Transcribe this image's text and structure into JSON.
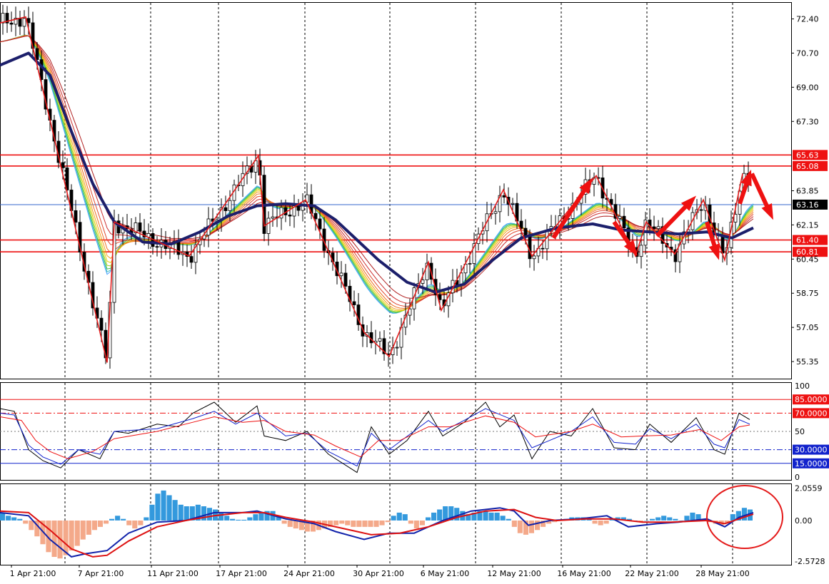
{
  "chart_data": [
    {
      "type": "candlestick",
      "panel": "price",
      "ylim": [
        54.5,
        73.2
      ],
      "yticks": [
        "72.40",
        "70.70",
        "69.00",
        "67.30",
        "65.63",
        "65.08",
        "63.85",
        "63.16",
        "62.15",
        "61.40",
        "60.81",
        "60.45",
        "58.75",
        "57.05",
        "55.35"
      ],
      "horizontal_levels": [
        {
          "label": "65.63",
          "value": 65.63,
          "color": "#ee1111",
          "highlight": true
        },
        {
          "label": "65.08",
          "value": 65.08,
          "color": "#ee1111",
          "highlight": true
        },
        {
          "label": "61.40",
          "value": 61.4,
          "color": "#ee1111",
          "highlight": true
        },
        {
          "label": "60.81",
          "value": 60.81,
          "color": "#ee1111",
          "highlight": true
        },
        {
          "label": "63.16",
          "value": 63.16,
          "color": "#3366cc",
          "highlight": false,
          "current": true
        }
      ],
      "zigzag": [
        [
          0,
          72.2
        ],
        [
          36,
          72.5
        ],
        [
          150,
          55.3
        ],
        [
          160,
          62.3
        ],
        [
          265,
          60.6
        ],
        [
          362,
          65.6
        ],
        [
          370,
          62.1
        ],
        [
          428,
          63.4
        ],
        [
          510,
          56.8
        ],
        [
          545,
          55.6
        ],
        [
          600,
          60.3
        ],
        [
          618,
          57.9
        ],
        [
          705,
          63.9
        ],
        [
          745,
          60.6
        ],
        [
          835,
          64.6
        ],
        [
          890,
          60.6
        ],
        [
          905,
          62.3
        ],
        [
          945,
          60.7
        ],
        [
          985,
          63.4
        ],
        [
          1015,
          60.4
        ],
        [
          1040,
          64.7
        ]
      ],
      "ma_slow": [
        [
          0,
          70.1
        ],
        [
          40,
          70.7
        ],
        [
          70,
          69.6
        ],
        [
          100,
          66.8
        ],
        [
          130,
          64.2
        ],
        [
          160,
          62.3
        ],
        [
          200,
          61.3
        ],
        [
          240,
          61.2
        ],
        [
          280,
          61.8
        ],
        [
          320,
          62.6
        ],
        [
          360,
          63.1
        ],
        [
          400,
          63.2
        ],
        [
          440,
          63.1
        ],
        [
          470,
          62.4
        ],
        [
          500,
          61.4
        ],
        [
          530,
          60.4
        ],
        [
          570,
          59.3
        ],
        [
          610,
          58.8
        ],
        [
          650,
          59.2
        ],
        [
          690,
          60.4
        ],
        [
          730,
          61.5
        ],
        [
          780,
          62.0
        ],
        [
          830,
          62.2
        ],
        [
          870,
          61.9
        ],
        [
          910,
          61.8
        ],
        [
          950,
          61.7
        ],
        [
          990,
          61.8
        ],
        [
          1025,
          61.5
        ],
        [
          1055,
          62.0
        ]
      ],
      "arrows": [
        {
          "from": [
            775,
            61.5
          ],
          "to": [
            830,
            64.5
          ]
        },
        {
          "from": [
            860,
            62.3
          ],
          "to": [
            893,
            60.6
          ]
        },
        {
          "from": [
            920,
            61.6
          ],
          "to": [
            975,
            63.6
          ]
        },
        {
          "from": [
            990,
            62.3
          ],
          "to": [
            1007,
            60.4
          ]
        },
        {
          "from": [
            1036,
            63.2
          ],
          "to": [
            1052,
            64.9
          ]
        },
        {
          "from": [
            1053,
            64.7
          ],
          "to": [
            1083,
            62.4
          ]
        }
      ]
    },
    {
      "type": "line",
      "panel": "oscillator",
      "ylim": [
        0,
        100
      ],
      "yticks": [
        "100",
        "50",
        "0"
      ],
      "levels": [
        {
          "label": "85.0000",
          "value": 85,
          "color": "#ee1111",
          "style": "solid"
        },
        {
          "label": "70.0000",
          "value": 70,
          "color": "#ee1111",
          "style": "dashdot"
        },
        {
          "label": "30.0000",
          "value": 30,
          "color": "#1122cc",
          "style": "dashdot"
        },
        {
          "label": "15.0000",
          "value": 15,
          "color": "#1122cc",
          "style": "solid"
        }
      ],
      "series": [
        {
          "color": "#000000",
          "values": [
            [
              0,
              75
            ],
            [
              20,
              72
            ],
            [
              40,
              30
            ],
            [
              60,
              18
            ],
            [
              85,
              10
            ],
            [
              110,
              30
            ],
            [
              140,
              20
            ],
            [
              160,
              50
            ],
            [
              180,
              48
            ],
            [
              220,
              58
            ],
            [
              250,
              55
            ],
            [
              270,
              70
            ],
            [
              300,
              82
            ],
            [
              330,
              60
            ],
            [
              360,
              78
            ],
            [
              370,
              45
            ],
            [
              400,
              40
            ],
            [
              430,
              50
            ],
            [
              460,
              25
            ],
            [
              500,
              5
            ],
            [
              520,
              55
            ],
            [
              545,
              25
            ],
            [
              570,
              40
            ],
            [
              600,
              72
            ],
            [
              620,
              45
            ],
            [
              650,
              60
            ],
            [
              680,
              82
            ],
            [
              700,
              55
            ],
            [
              720,
              68
            ],
            [
              745,
              20
            ],
            [
              770,
              50
            ],
            [
              800,
              45
            ],
            [
              830,
              75
            ],
            [
              860,
              32
            ],
            [
              890,
              30
            ],
            [
              910,
              58
            ],
            [
              940,
              38
            ],
            [
              975,
              65
            ],
            [
              1000,
              30
            ],
            [
              1015,
              25
            ],
            [
              1035,
              70
            ],
            [
              1050,
              63
            ]
          ]
        },
        {
          "color": "#1122cc",
          "values": [
            [
              0,
              70
            ],
            [
              20,
              68
            ],
            [
              40,
              35
            ],
            [
              60,
              22
            ],
            [
              85,
              14
            ],
            [
              110,
              30
            ],
            [
              140,
              25
            ],
            [
              160,
              50
            ],
            [
              220,
              53
            ],
            [
              270,
              64
            ],
            [
              300,
              72
            ],
            [
              330,
              58
            ],
            [
              360,
              70
            ],
            [
              400,
              45
            ],
            [
              430,
              48
            ],
            [
              460,
              28
            ],
            [
              500,
              12
            ],
            [
              520,
              48
            ],
            [
              545,
              30
            ],
            [
              600,
              62
            ],
            [
              620,
              50
            ],
            [
              650,
              62
            ],
            [
              680,
              75
            ],
            [
              720,
              62
            ],
            [
              745,
              32
            ],
            [
              800,
              50
            ],
            [
              830,
              66
            ],
            [
              860,
              38
            ],
            [
              890,
              36
            ],
            [
              910,
              53
            ],
            [
              940,
              42
            ],
            [
              975,
              58
            ],
            [
              1000,
              36
            ],
            [
              1015,
              32
            ],
            [
              1035,
              63
            ],
            [
              1050,
              58
            ]
          ]
        },
        {
          "color": "#ee1111",
          "values": [
            [
              0,
              66
            ],
            [
              30,
              62
            ],
            [
              50,
              40
            ],
            [
              70,
              28
            ],
            [
              95,
              20
            ],
            [
              130,
              28
            ],
            [
              160,
              42
            ],
            [
              220,
              50
            ],
            [
              270,
              60
            ],
            [
              300,
              66
            ],
            [
              340,
              60
            ],
            [
              370,
              62
            ],
            [
              400,
              50
            ],
            [
              440,
              46
            ],
            [
              470,
              34
            ],
            [
              505,
              22
            ],
            [
              530,
              40
            ],
            [
              560,
              40
            ],
            [
              600,
              55
            ],
            [
              630,
              55
            ],
            [
              680,
              67
            ],
            [
              720,
              60
            ],
            [
              750,
              44
            ],
            [
              800,
              50
            ],
            [
              830,
              58
            ],
            [
              870,
              44
            ],
            [
              900,
              45
            ],
            [
              940,
              46
            ],
            [
              980,
              52
            ],
            [
              1010,
              40
            ],
            [
              1035,
              55
            ],
            [
              1050,
              57
            ]
          ]
        }
      ]
    },
    {
      "type": "histogram",
      "panel": "macd",
      "ylim": [
        -2.8,
        2.3
      ],
      "yticks": [
        "2.0559",
        "0.00",
        "-2.5728"
      ],
      "histogram": [
        0.45,
        0.3,
        0.2,
        0.1,
        -0.2,
        -0.6,
        -1.0,
        -1.5,
        -2.0,
        -2.3,
        -2.4,
        -2.2,
        -1.9,
        -1.6,
        -1.2,
        -0.9,
        -0.6,
        -0.4,
        -0.2,
        0.1,
        0.3,
        0.1,
        -0.3,
        -0.5,
        -0.3,
        0.2,
        1.0,
        1.7,
        1.9,
        1.6,
        1.3,
        1.0,
        0.9,
        0.9,
        1.0,
        0.9,
        0.8,
        0.7,
        0.5,
        0.3,
        0.1,
        0.05,
        0.05,
        0.2,
        0.4,
        0.5,
        0.6,
        0.6,
        0.3,
        -0.2,
        -0.4,
        -0.5,
        -0.6,
        -0.7,
        -0.7,
        -0.6,
        -0.5,
        -0.4,
        -0.3,
        -0.2,
        -0.3,
        -0.4,
        -0.4,
        -0.4,
        -0.4,
        -0.4,
        -0.3,
        -0.1,
        0.3,
        0.5,
        0.4,
        -0.2,
        -0.5,
        -0.3,
        0.2,
        0.5,
        0.7,
        0.9,
        0.9,
        0.8,
        0.6,
        0.4,
        0.5,
        0.6,
        0.6,
        0.5,
        0.5,
        0.3,
        0.1,
        -0.4,
        -0.8,
        -0.9,
        -0.8,
        -0.6,
        -0.4,
        -0.2,
        -0.1,
        0.0,
        0.1,
        0.2,
        0.2,
        0.2,
        0.1,
        -0.2,
        -0.3,
        -0.2,
        0.1,
        0.2,
        0.2,
        0.1,
        0.0,
        -0.1,
        0.0,
        0.1,
        0.2,
        0.3,
        0.2,
        0.1,
        0.0,
        0.3,
        0.5,
        0.4,
        0.1,
        -0.1,
        -0.2,
        -0.3,
        -0.2,
        0.4,
        0.6,
        0.8,
        0.7
      ],
      "series": [
        {
          "color": "#1122aa",
          "values": [
            [
              0,
              0.5
            ],
            [
              40,
              0.3
            ],
            [
              70,
              -1.2
            ],
            [
              100,
              -2.3
            ],
            [
              120,
              -2.1
            ],
            [
              150,
              -1.9
            ],
            [
              180,
              -0.8
            ],
            [
              220,
              -0.1
            ],
            [
              260,
              0.0
            ],
            [
              300,
              0.5
            ],
            [
              340,
              0.5
            ],
            [
              360,
              0.6
            ],
            [
              400,
              0.1
            ],
            [
              440,
              -0.2
            ],
            [
              470,
              -0.7
            ],
            [
              510,
              -1.2
            ],
            [
              545,
              -0.8
            ],
            [
              580,
              -0.8
            ],
            [
              620,
              0.0
            ],
            [
              660,
              0.6
            ],
            [
              700,
              0.8
            ],
            [
              720,
              0.6
            ],
            [
              740,
              -0.3
            ],
            [
              770,
              0.0
            ],
            [
              810,
              0.1
            ],
            [
              850,
              0.3
            ],
            [
              880,
              -0.4
            ],
            [
              920,
              -0.2
            ],
            [
              950,
              -0.1
            ],
            [
              990,
              0.1
            ],
            [
              1015,
              -0.4
            ],
            [
              1035,
              0.2
            ],
            [
              1055,
              0.5
            ]
          ]
        },
        {
          "color": "#dd1111",
          "values": [
            [
              0,
              0.6
            ],
            [
              40,
              0.5
            ],
            [
              70,
              -0.6
            ],
            [
              100,
              -1.8
            ],
            [
              130,
              -2.3
            ],
            [
              150,
              -2.2
            ],
            [
              180,
              -1.3
            ],
            [
              220,
              -0.4
            ],
            [
              260,
              0.0
            ],
            [
              300,
              0.3
            ],
            [
              340,
              0.5
            ],
            [
              370,
              0.5
            ],
            [
              400,
              0.2
            ],
            [
              440,
              -0.1
            ],
            [
              480,
              -0.5
            ],
            [
              520,
              -0.9
            ],
            [
              560,
              -0.8
            ],
            [
              600,
              -0.4
            ],
            [
              640,
              0.2
            ],
            [
              680,
              0.6
            ],
            [
              720,
              0.7
            ],
            [
              750,
              0.2
            ],
            [
              780,
              0.0
            ],
            [
              820,
              0.1
            ],
            [
              860,
              0.1
            ],
            [
              900,
              -0.1
            ],
            [
              940,
              -0.1
            ],
            [
              990,
              0.0
            ],
            [
              1015,
              -0.2
            ],
            [
              1035,
              0.1
            ],
            [
              1055,
              0.4
            ]
          ]
        }
      ]
    }
  ],
  "x_axis": {
    "labels": [
      "1 Apr 21:00",
      "7 Apr 21:00",
      "11 Apr 21:00",
      "17 Apr 21:00",
      "24 Apr 21:00",
      "30 Apr 21:00",
      "6 May 21:00",
      "12 May 21:00",
      "16 May 21:00",
      "22 May 21:00",
      "28 May 21:00"
    ]
  },
  "colors": {
    "level_line": "#ee1111",
    "label_bg": "#ee1111",
    "current_bg": "#000000",
    "ma_slow": "#1c1f6b",
    "zigzag": "#e41a1a",
    "hist_pos": "#3399dd",
    "hist_neg": "#f4a98a",
    "grid": "#000000",
    "circle": "#e41a1a"
  }
}
